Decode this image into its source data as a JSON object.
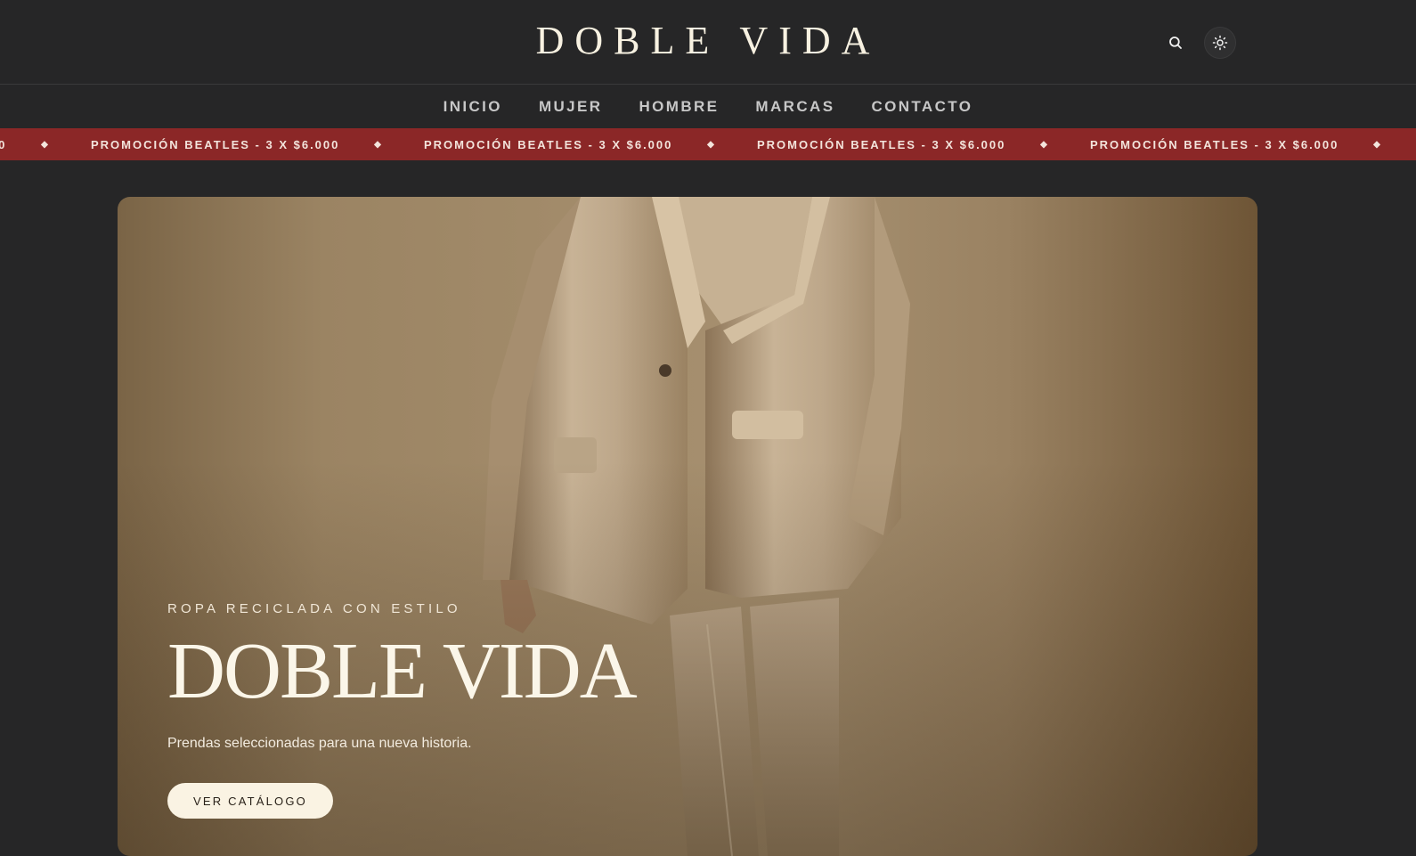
{
  "header": {
    "brand": "DOBLE VIDA",
    "search_icon": "search-icon",
    "theme_icon": "sun-icon"
  },
  "nav": {
    "items": [
      {
        "label": "INICIO"
      },
      {
        "label": "MUJER"
      },
      {
        "label": "HOMBRE"
      },
      {
        "label": "MARCAS"
      },
      {
        "label": "CONTACTO"
      }
    ]
  },
  "ticker": {
    "text": "PROMOCIÓN BEATLES - 3 X $6.000",
    "separator": "◆",
    "background": "#8b2727"
  },
  "hero": {
    "eyebrow": "ROPA RECICLADA CON ESTILO",
    "title": "DOBLE VIDA",
    "subtitle": "Prendas seleccionadas para una nueva historia.",
    "cta_label": "VER CATÁLOGO"
  },
  "colors": {
    "page_background": "#262627",
    "accent_red": "#8b2727",
    "cream": "#faf3e3"
  }
}
